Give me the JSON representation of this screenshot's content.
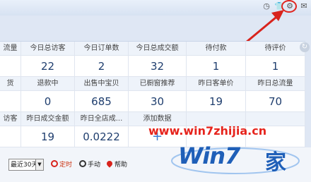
{
  "topbar": {
    "icons": [
      "clock-icon",
      "shirt-icon",
      "gear-icon",
      "mail-icon"
    ]
  },
  "stats": {
    "row1": {
      "headers": [
        "流量",
        "今日总访客",
        "今日订单数",
        "今日总成交额",
        "待付款",
        "待评价"
      ],
      "values": [
        "",
        "22",
        "2",
        "32",
        "1",
        "1"
      ]
    },
    "row2": {
      "headers": [
        "货",
        "退款中",
        "出售中宝贝",
        "已橱窗推荐",
        "昨日客单价",
        "昨日总流量"
      ],
      "values": [
        "",
        "0",
        "685",
        "30",
        "19",
        "70"
      ]
    },
    "row3": {
      "headers": [
        "访客",
        "昨日成交金额",
        "昨日全店成...",
        "添加数据",
        "",
        ""
      ],
      "values": [
        "",
        "19",
        "0.0222",
        "+",
        "",
        ""
      ]
    }
  },
  "toolbar": {
    "range_select": "最近30天",
    "timer_label": "定时",
    "manual_label": "手动",
    "help_label": "帮助"
  },
  "watermark": {
    "url": "www.win7zhijia.cn",
    "logo_text": "Win7",
    "logo_char": "家"
  }
}
